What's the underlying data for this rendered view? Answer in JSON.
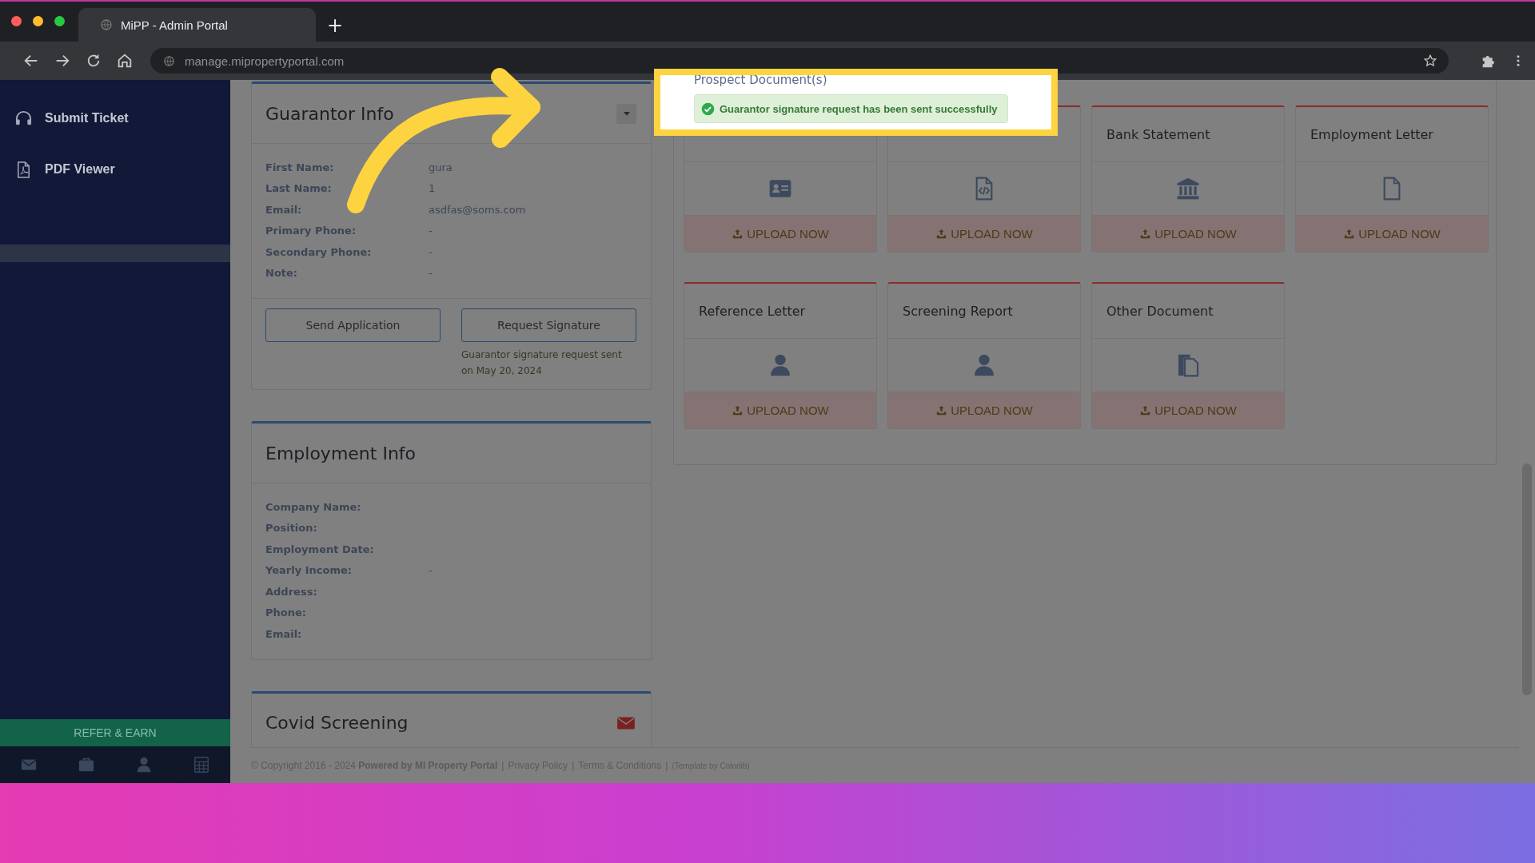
{
  "browser": {
    "tab_title": "MiPP - Admin Portal",
    "new_tab": "+",
    "url": "manage.mipropertyportal.com"
  },
  "sidebar": {
    "items": [
      {
        "label": "Submit Ticket",
        "kind": "headset"
      },
      {
        "label": "PDF Viewer",
        "kind": "pdf"
      }
    ],
    "refer_button": "REFER & EARN"
  },
  "guarantor": {
    "title": "Guarantor Info",
    "fields": [
      {
        "label": "First Name:",
        "value": "gura"
      },
      {
        "label": "Last Name:",
        "value": "1"
      },
      {
        "label": "Email:",
        "value": "asdfas@soms.com"
      },
      {
        "label": "Primary Phone:",
        "value": "-"
      },
      {
        "label": "Secondary Phone:",
        "value": "-"
      },
      {
        "label": "Note:",
        "value": "-"
      }
    ],
    "buttons": [
      "Send Application",
      "Request Signature"
    ],
    "note": "Guarantor signature request sent on May 20, 2024"
  },
  "employment": {
    "title": "Employment Info",
    "fields": [
      {
        "label": "Company Name:"
      },
      {
        "label": "Position:"
      },
      {
        "label": "Employment Date:"
      },
      {
        "label": "Yearly Income:",
        "value": "-"
      },
      {
        "label": "Address:"
      },
      {
        "label": "Phone:"
      },
      {
        "label": "Email:"
      }
    ]
  },
  "covid": {
    "title": "Covid Screening"
  },
  "documents": {
    "heading": "Prospect Document(s)",
    "toast": "Guarantor signature request has been sent successfully",
    "cards": [
      {
        "kind": "id-card",
        "action": "UPLOAD NOW"
      },
      {
        "kind": "code-file",
        "action": "UPLOAD NOW"
      },
      {
        "title": "Bank Statement",
        "kind": "bank",
        "action": "UPLOAD NOW"
      },
      {
        "title": "Employment Letter",
        "kind": "file",
        "action": "UPLOAD NOW"
      },
      {
        "title": "Reference Letter",
        "kind": "user",
        "action": "UPLOAD NOW"
      },
      {
        "title": "Screening Report",
        "kind": "user",
        "action": "UPLOAD NOW"
      },
      {
        "title": "Other Document",
        "kind": "files",
        "action": "UPLOAD NOW"
      }
    ]
  },
  "footer": [
    {
      "kind": "text",
      "text": "© Copyright 2016 - 2024 **Powered by MI Property Portal**"
    },
    {
      "kind": "sep",
      "text": "|"
    },
    {
      "kind": "link",
      "text": "Privacy Policy"
    },
    {
      "kind": "sep",
      "text": "|"
    },
    {
      "kind": "link",
      "text": "Terms & Conditions"
    },
    {
      "kind": "sep",
      "text": "|"
    },
    {
      "kind": "small",
      "text": "(Template by Colorlib)"
    }
  ]
}
